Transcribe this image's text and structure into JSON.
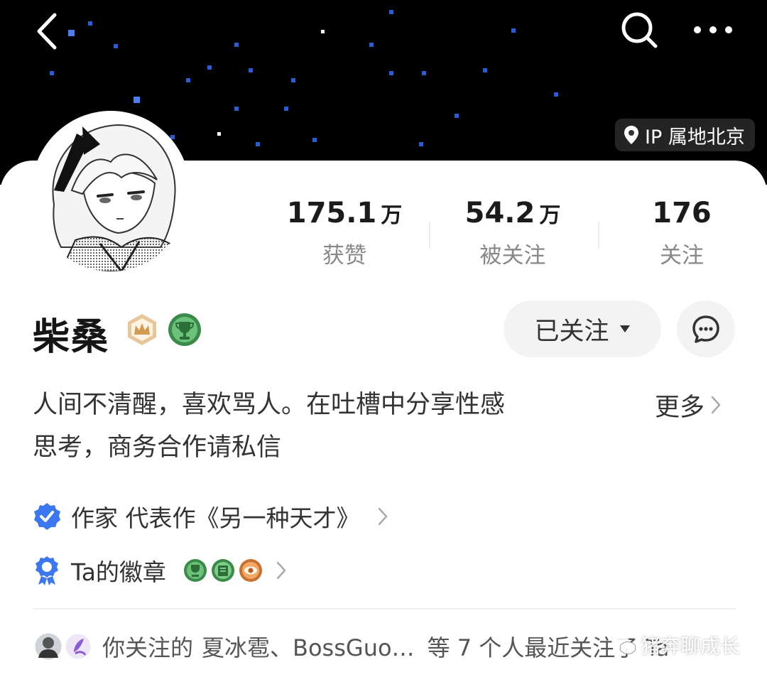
{
  "header": {
    "ip_label": "IP 属地北京"
  },
  "stats": [
    {
      "value": "175.1",
      "unit": "万",
      "label": "获赞"
    },
    {
      "value": "54.2",
      "unit": "万",
      "label": "被关注"
    },
    {
      "value": "176",
      "unit": "",
      "label": "关注"
    }
  ],
  "profile": {
    "name": "柴桑",
    "follow_label": "已关注",
    "bio_line1": "人间不清醒，喜欢骂人。在吐槽中分享性感",
    "bio_line2": "思考，商务合作请私信",
    "more_label": "更多"
  },
  "certification": {
    "text": "作家 代表作《另一种天才》"
  },
  "badges": {
    "label": "Ta的徽章"
  },
  "mutual": {
    "prefix": "你关注的",
    "names": "夏冰雹、BossGuo…",
    "suffix": "等 7 个人最近关注了 Ta"
  },
  "watermark": {
    "text": "猪奔聊成长"
  },
  "colors": {
    "accent_blue": "#3b77f0",
    "crown_gold": "#d8b27a",
    "trophy_green": "#49a35a",
    "badge_orange": "#e38a4a"
  }
}
